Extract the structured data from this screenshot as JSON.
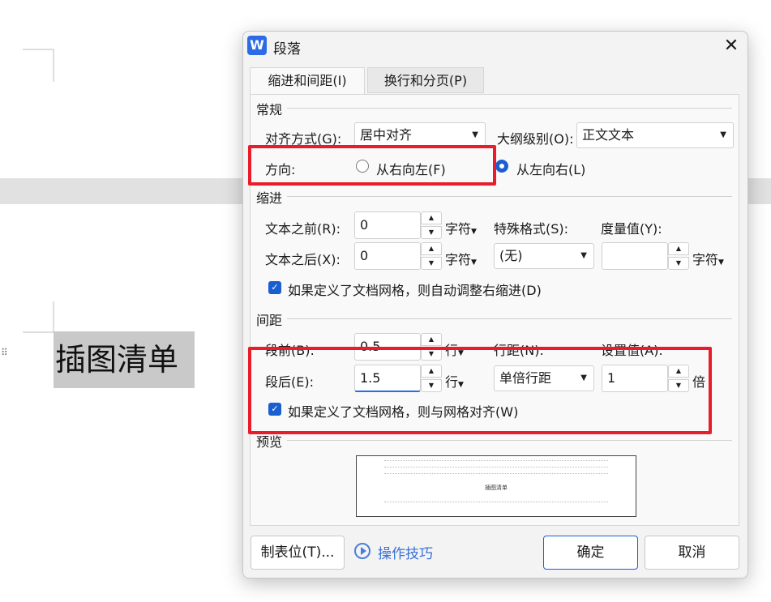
{
  "document": {
    "heading": "插图清单",
    "drag_handle": "⠿"
  },
  "dialog": {
    "app_icon_letter": "W",
    "title": "段落",
    "close_icon": "✕",
    "tabs": [
      {
        "label": "缩进和间距(I)",
        "active": true
      },
      {
        "label": "换行和分页(P)",
        "active": false
      }
    ],
    "general": {
      "section_title": "常规",
      "alignment_label": "对齐方式(G):",
      "alignment_value": "居中对齐",
      "outline_label": "大纲级别(O):",
      "outline_value": "正文文本",
      "direction_label": "方向:",
      "direction_rtl": "从右向左(F)",
      "direction_ltr": "从左向右(L)",
      "direction_selected": "ltr"
    },
    "indent": {
      "section_title": "缩进",
      "before_label": "文本之前(R):",
      "before_value": "0",
      "before_unit": "字符",
      "after_label": "文本之后(X):",
      "after_value": "0",
      "after_unit": "字符",
      "special_label": "特殊格式(S):",
      "special_value": "(无)",
      "measure_label": "度量值(Y):",
      "measure_value": "",
      "measure_unit": "字符",
      "auto_adjust_checkbox": "如果定义了文档网格，则自动调整右缩进(D)",
      "auto_adjust_checked": true
    },
    "spacing": {
      "section_title": "间距",
      "before_label": "段前(B):",
      "before_value": "0.5",
      "before_unit": "行",
      "after_label": "段后(E):",
      "after_value": "1.5",
      "after_unit": "行",
      "line_spacing_label": "行距(N):",
      "line_spacing_value": "单倍行距",
      "set_value_label": "设置值(A):",
      "set_value": "1",
      "set_value_unit": "倍",
      "grid_align_checkbox": "如果定义了文档网格，则与网格对齐(W)",
      "grid_align_checked": true
    },
    "preview": {
      "section_title": "预览",
      "sample_text": "插图清单"
    },
    "footer": {
      "tabs_button": "制表位(T)...",
      "tips_link": "操作技巧",
      "ok_button": "确定",
      "cancel_button": "取消"
    }
  },
  "icons": {
    "caret": "▼",
    "spin_up": "▲",
    "spin_down": "▼",
    "check": "✓"
  },
  "colors": {
    "highlight_red": "#e81c2a",
    "accent_blue": "#1a5fd0",
    "app_icon_blue": "#2b6ce6"
  }
}
